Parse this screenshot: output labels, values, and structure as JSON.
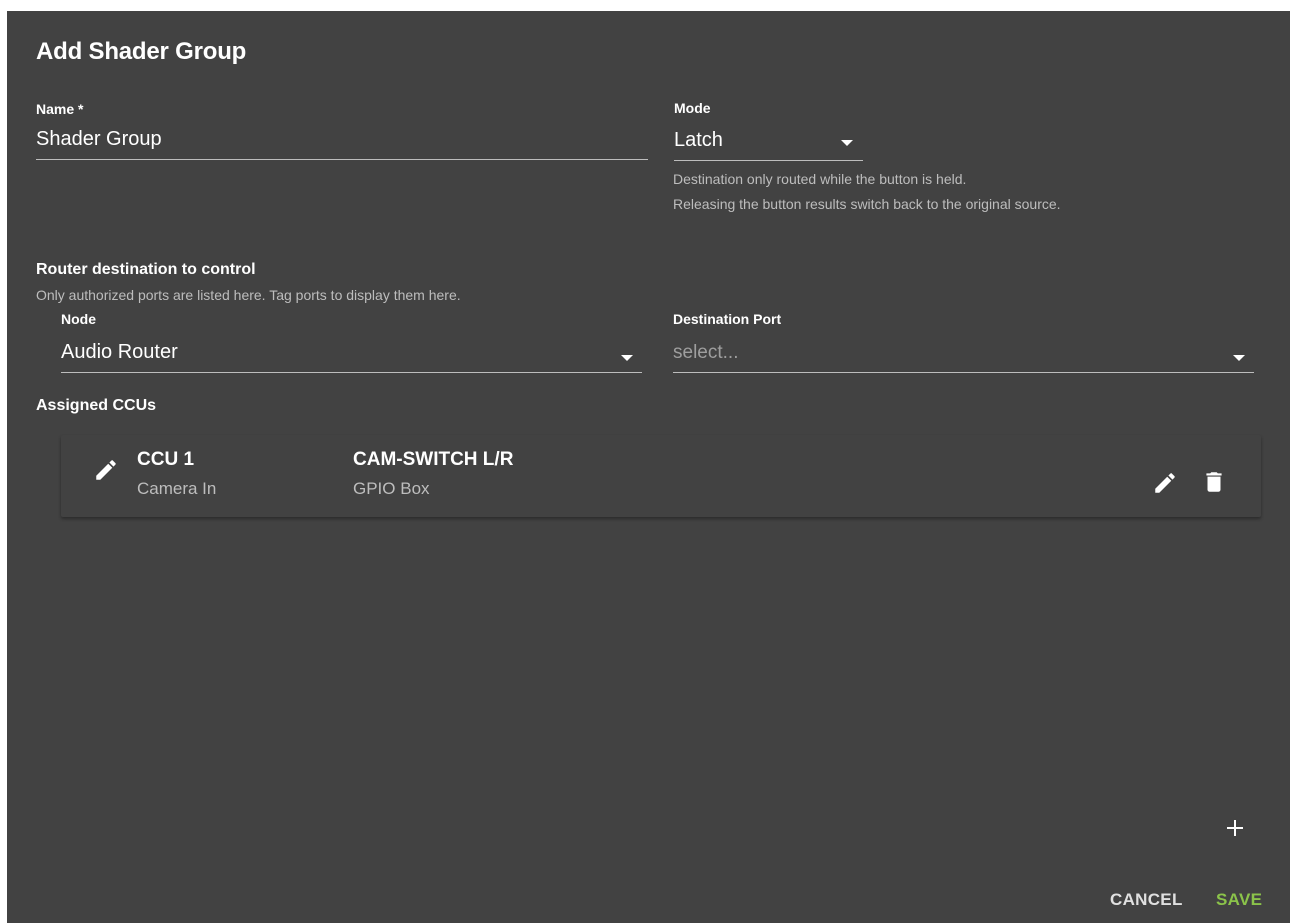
{
  "dialog": {
    "title": "Add Shader Group"
  },
  "name_field": {
    "label": "Name *",
    "value": "Shader Group"
  },
  "mode_field": {
    "label": "Mode",
    "value": "Latch",
    "helper_lines": [
      "Destination only routed while the button is held.",
      "Releasing the button results switch back to the original source."
    ]
  },
  "router_section": {
    "heading": "Router destination to control",
    "helper": "Only authorized ports are listed here. Tag ports to display them here.",
    "node": {
      "label": "Node",
      "value": "Audio Router"
    },
    "destination_port": {
      "label": "Destination Port",
      "placeholder": "select..."
    }
  },
  "assigned_ccus": {
    "heading": "Assigned CCUs",
    "items": [
      {
        "ccu_name": "CCU 1",
        "ccu_sub": "Camera In",
        "target_name": "CAM-SWITCH L/R",
        "target_sub": "GPIO Box"
      }
    ]
  },
  "icons": {
    "edit": "pencil-icon",
    "delete": "trash-icon",
    "add": "plus-icon",
    "dropdown": "caret-down-icon"
  },
  "footer": {
    "cancel_label": "CANCEL",
    "save_label": "SAVE"
  },
  "colors": {
    "dialog_background": "#424242",
    "save_accent": "#8bc34a",
    "cancel_text": "#e0e0e0",
    "underline": "#bdbdbd",
    "helper_text": "#bdbdbd"
  }
}
